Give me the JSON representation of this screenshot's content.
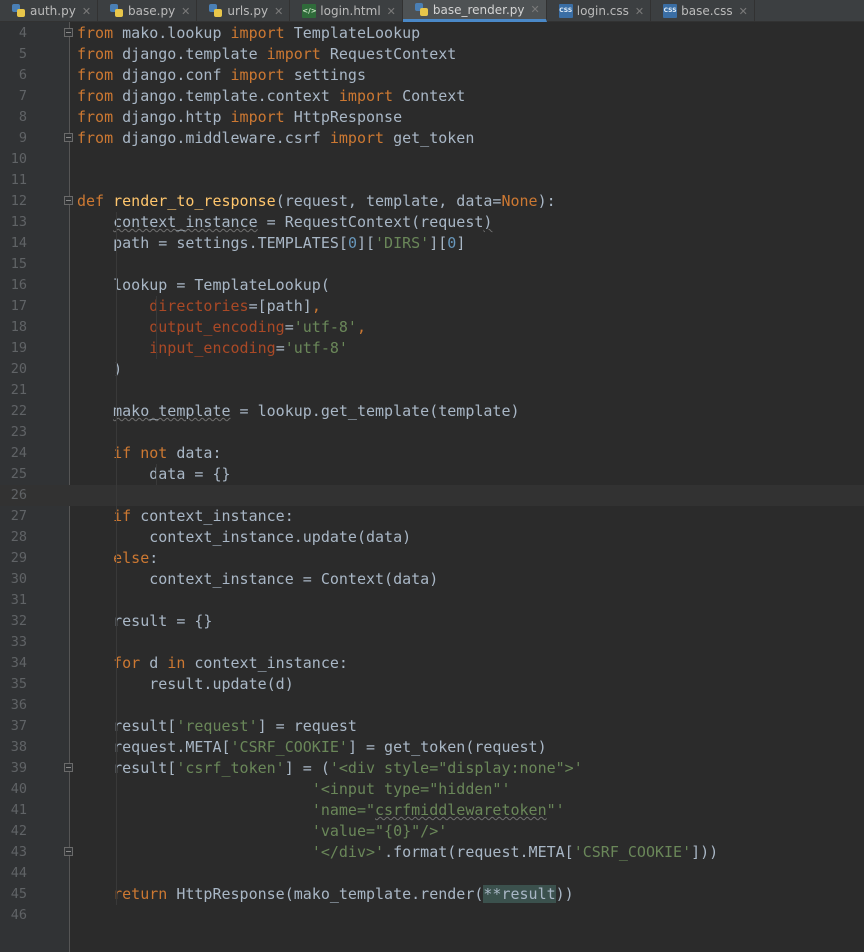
{
  "tabs": [
    {
      "label": "auth.py",
      "type": "py",
      "active": false
    },
    {
      "label": "base.py",
      "type": "py",
      "active": false
    },
    {
      "label": "urls.py",
      "type": "py",
      "active": false
    },
    {
      "label": "login.html",
      "type": "html",
      "active": false
    },
    {
      "label": "base_render.py",
      "type": "py",
      "active": true
    },
    {
      "label": "login.css",
      "type": "css",
      "active": false
    },
    {
      "label": "base.css",
      "type": "css",
      "active": false
    }
  ],
  "icons": {
    "close": "close-icon",
    "fold": "fold-marker-icon",
    "py": "python-file-icon",
    "html": "html-file-icon",
    "css": "css-file-icon"
  },
  "colors": {
    "keyword": "#cc7832",
    "function": "#ffc66d",
    "string": "#6a8759",
    "number": "#6897bb",
    "param": "#aa4926",
    "text": "#a9b7c6",
    "background": "#2b2b2b"
  },
  "current_line": 26,
  "lines": [
    {
      "n": "4",
      "fold": true,
      "tokens": [
        [
          "kw",
          "from"
        ],
        [
          "t",
          " mako.lookup "
        ],
        [
          "kw",
          "import"
        ],
        [
          "t",
          " TemplateLookup"
        ]
      ]
    },
    {
      "n": "5",
      "tokens": [
        [
          "kw",
          "from"
        ],
        [
          "t",
          " django.template "
        ],
        [
          "kw",
          "import"
        ],
        [
          "t",
          " RequestContext"
        ]
      ]
    },
    {
      "n": "6",
      "tokens": [
        [
          "kw",
          "from"
        ],
        [
          "t",
          " django.conf "
        ],
        [
          "kw",
          "import"
        ],
        [
          "t",
          " settings"
        ]
      ]
    },
    {
      "n": "7",
      "tokens": [
        [
          "kw",
          "from"
        ],
        [
          "t",
          " django.template.context "
        ],
        [
          "kw",
          "import"
        ],
        [
          "t",
          " Context"
        ]
      ]
    },
    {
      "n": "8",
      "tokens": [
        [
          "kw",
          "from"
        ],
        [
          "t",
          " django.http "
        ],
        [
          "kw",
          "import"
        ],
        [
          "t",
          " HttpResponse"
        ]
      ]
    },
    {
      "n": "9",
      "fold": true,
      "tokens": [
        [
          "kw",
          "from"
        ],
        [
          "t",
          " django.middleware.csrf "
        ],
        [
          "kw",
          "import"
        ],
        [
          "t",
          " get_token"
        ]
      ]
    },
    {
      "n": "10",
      "tokens": []
    },
    {
      "n": "11",
      "tokens": []
    },
    {
      "n": "12",
      "fold": true,
      "tokens": [
        [
          "kw",
          "def "
        ],
        [
          "fn",
          "render_to_response"
        ],
        [
          "t",
          "(request, template, data="
        ],
        [
          "kw",
          "None"
        ],
        [
          "t",
          "):"
        ]
      ]
    },
    {
      "n": "13",
      "tokens": [
        [
          "t",
          "    "
        ],
        [
          "sq",
          "context_instance"
        ],
        [
          "t",
          " = RequestContext(request"
        ],
        [
          "sq",
          ")"
        ]
      ]
    },
    {
      "n": "14",
      "tokens": [
        [
          "t",
          "    path = settings.TEMPLATES["
        ],
        [
          "num",
          "0"
        ],
        [
          "t",
          "]["
        ],
        [
          "str",
          "'DIRS'"
        ],
        [
          "t",
          "]["
        ],
        [
          "num",
          "0"
        ],
        [
          "t",
          "]"
        ]
      ]
    },
    {
      "n": "15",
      "tokens": []
    },
    {
      "n": "16",
      "tokens": [
        [
          "t",
          "    lookup = TemplateLookup("
        ]
      ]
    },
    {
      "n": "17",
      "tokens": [
        [
          "t",
          "        "
        ],
        [
          "param",
          "directories"
        ],
        [
          "t",
          "=[path]"
        ],
        [
          "kw",
          ","
        ]
      ]
    },
    {
      "n": "18",
      "tokens": [
        [
          "t",
          "        "
        ],
        [
          "param",
          "output_encoding"
        ],
        [
          "t",
          "="
        ],
        [
          "str",
          "'utf-8'"
        ],
        [
          "kw",
          ","
        ]
      ]
    },
    {
      "n": "19",
      "tokens": [
        [
          "t",
          "        "
        ],
        [
          "param",
          "input_encoding"
        ],
        [
          "t",
          "="
        ],
        [
          "str",
          "'utf-8'"
        ]
      ]
    },
    {
      "n": "20",
      "tokens": [
        [
          "t",
          "    )"
        ]
      ]
    },
    {
      "n": "21",
      "tokens": []
    },
    {
      "n": "22",
      "tokens": [
        [
          "t",
          "    "
        ],
        [
          "sq",
          "mako_template"
        ],
        [
          "t",
          " = lookup.get_template(template)"
        ]
      ]
    },
    {
      "n": "23",
      "tokens": []
    },
    {
      "n": "24",
      "tokens": [
        [
          "t",
          "    "
        ],
        [
          "kw",
          "if not"
        ],
        [
          "t",
          " data:"
        ]
      ]
    },
    {
      "n": "25",
      "tokens": [
        [
          "t",
          "        data = {}"
        ]
      ]
    },
    {
      "n": "26",
      "tokens": []
    },
    {
      "n": "27",
      "tokens": [
        [
          "t",
          "    "
        ],
        [
          "kw",
          "if"
        ],
        [
          "t",
          " context_instance:"
        ]
      ]
    },
    {
      "n": "28",
      "tokens": [
        [
          "t",
          "        context_instance.update(data)"
        ]
      ]
    },
    {
      "n": "29",
      "tokens": [
        [
          "t",
          "    "
        ],
        [
          "kw",
          "else"
        ],
        [
          "t",
          ":"
        ]
      ]
    },
    {
      "n": "30",
      "tokens": [
        [
          "t",
          "        context_instance = Context(data)"
        ]
      ]
    },
    {
      "n": "31",
      "tokens": []
    },
    {
      "n": "32",
      "tokens": [
        [
          "t",
          "    result = {}"
        ]
      ]
    },
    {
      "n": "33",
      "tokens": []
    },
    {
      "n": "34",
      "tokens": [
        [
          "t",
          "    "
        ],
        [
          "kw",
          "for"
        ],
        [
          "t",
          " d "
        ],
        [
          "kw",
          "in"
        ],
        [
          "t",
          " context_instance:"
        ]
      ]
    },
    {
      "n": "35",
      "tokens": [
        [
          "t",
          "        result.update(d)"
        ]
      ]
    },
    {
      "n": "36",
      "tokens": []
    },
    {
      "n": "37",
      "tokens": [
        [
          "t",
          "    result["
        ],
        [
          "str",
          "'request'"
        ],
        [
          "t",
          "] = request"
        ]
      ]
    },
    {
      "n": "38",
      "tokens": [
        [
          "t",
          "    request.META["
        ],
        [
          "str",
          "'CSRF_COOKIE'"
        ],
        [
          "t",
          "] = get_token(request)"
        ]
      ]
    },
    {
      "n": "39",
      "fold": true,
      "tokens": [
        [
          "t",
          "    result["
        ],
        [
          "str",
          "'csrf_token'"
        ],
        [
          "t",
          "] = ("
        ],
        [
          "str",
          "'<div style=\"display:none\">'"
        ]
      ]
    },
    {
      "n": "40",
      "tokens": [
        [
          "t",
          "                          "
        ],
        [
          "str",
          "'<input type=\"hidden\"'"
        ]
      ]
    },
    {
      "n": "41",
      "tokens": [
        [
          "t",
          "                          "
        ],
        [
          "str",
          "'name=\""
        ],
        [
          "strsq",
          "csrfmiddlewaretoken"
        ],
        [
          "str",
          "\"'"
        ]
      ]
    },
    {
      "n": "42",
      "tokens": [
        [
          "t",
          "                          "
        ],
        [
          "str",
          "'value=\"{0}\"/>'"
        ]
      ]
    },
    {
      "n": "43",
      "fold": true,
      "tokens": [
        [
          "t",
          "                          "
        ],
        [
          "str",
          "'</div>'"
        ],
        [
          "t",
          ".format(request.META["
        ],
        [
          "str",
          "'CSRF_COOKIE'"
        ],
        [
          "t",
          "]))"
        ]
      ]
    },
    {
      "n": "44",
      "tokens": []
    },
    {
      "n": "45",
      "tokens": [
        [
          "t",
          "    "
        ],
        [
          "kw",
          "return"
        ],
        [
          "t",
          " HttpResponse(mako_template.render("
        ],
        [
          "dstar",
          "**result"
        ],
        [
          "t",
          "))"
        ]
      ]
    },
    {
      "n": "46",
      "tokens": []
    }
  ]
}
